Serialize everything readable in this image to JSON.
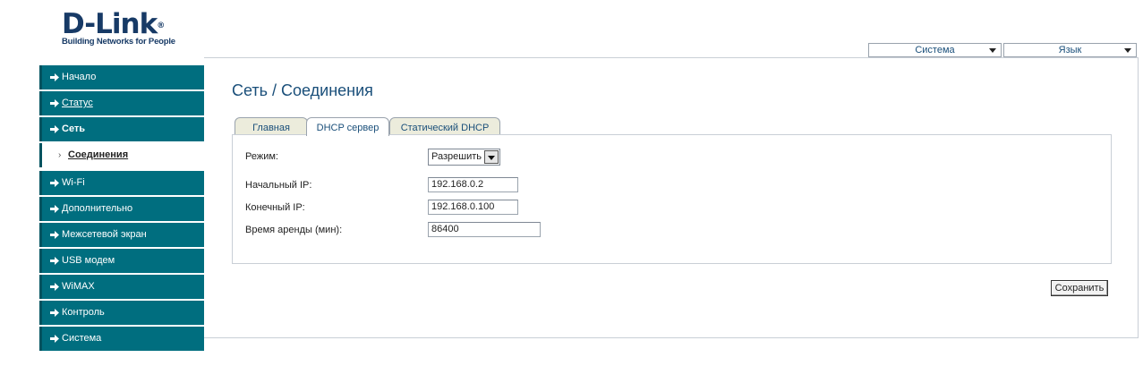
{
  "logo": {
    "brand": "D-Link",
    "mark": "®",
    "tagline": "Building Networks for People"
  },
  "top": {
    "system_label": "Система",
    "language_label": "Язык"
  },
  "sidebar": {
    "items": [
      {
        "label": "Начало"
      },
      {
        "label": "Статус"
      },
      {
        "label": "Сеть"
      },
      {
        "label": "Соединения"
      },
      {
        "label": "Wi-Fi"
      },
      {
        "label": "Дополнительно"
      },
      {
        "label": "Межсетевой экран"
      },
      {
        "label": "USB модем"
      },
      {
        "label": "WiMAX"
      },
      {
        "label": "Контроль"
      },
      {
        "label": "Система"
      }
    ]
  },
  "page": {
    "title": "Сеть  / Соединения"
  },
  "tabs": [
    {
      "label": "Главная"
    },
    {
      "label": "DHCP сервер"
    },
    {
      "label": "Статический DHCP"
    }
  ],
  "form": {
    "mode_label": "Режим:",
    "mode_value": "Разрешить",
    "start_ip_label": "Начальный IP:",
    "start_ip_value": "192.168.0.2",
    "end_ip_label": "Конечный IP:",
    "end_ip_value": "192.168.0.100",
    "lease_label": "Время аренды (мин):",
    "lease_value": "86400"
  },
  "actions": {
    "save_label": "Сохранить"
  },
  "colors": {
    "sidebar_bg": "#006e7f",
    "title": "#1a4f7a",
    "tab_inactive": "#ececdc"
  }
}
